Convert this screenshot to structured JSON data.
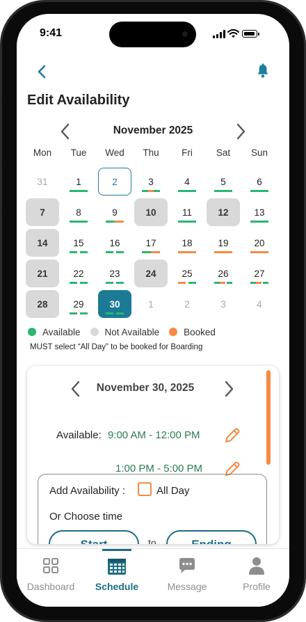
{
  "status_bar": {
    "time": "9:41"
  },
  "header": {
    "title": "Edit Availability"
  },
  "calendar": {
    "month_label": "November 2025",
    "weekdays": [
      "Mon",
      "Tue",
      "Wed",
      "Thu",
      "Fri",
      "Sat",
      "Sun"
    ],
    "days": [
      {
        "label": "31",
        "state": "other-month",
        "bars": []
      },
      {
        "label": "1",
        "state": "normal",
        "bars": [
          "available",
          "available"
        ]
      },
      {
        "label": "2",
        "state": "today",
        "bars": []
      },
      {
        "label": "3",
        "state": "normal",
        "bars": [
          "available",
          "booked",
          "available"
        ]
      },
      {
        "label": "4",
        "state": "normal",
        "bars": [
          "available",
          "available"
        ]
      },
      {
        "label": "5",
        "state": "normal",
        "bars": [
          "available",
          "available"
        ]
      },
      {
        "label": "6",
        "state": "normal",
        "bars": [
          "available",
          "available"
        ]
      },
      {
        "label": "7",
        "state": "not-available",
        "bars": []
      },
      {
        "label": "8",
        "state": "normal",
        "bars": [
          "available",
          "available"
        ]
      },
      {
        "label": "9",
        "state": "normal",
        "bars": [
          "available",
          "booked"
        ]
      },
      {
        "label": "10",
        "state": "not-available",
        "bars": []
      },
      {
        "label": "11",
        "state": "normal",
        "bars": [
          "available",
          "available"
        ]
      },
      {
        "label": "12",
        "state": "not-available",
        "bars": []
      },
      {
        "label": "13",
        "state": "normal",
        "bars": [
          "available",
          "available"
        ]
      },
      {
        "label": "14",
        "state": "not-available",
        "bars": []
      },
      {
        "label": "15",
        "state": "normal",
        "bars": [
          "available",
          "gap",
          "available"
        ]
      },
      {
        "label": "16",
        "state": "normal",
        "bars": [
          "available",
          "gap",
          "available"
        ]
      },
      {
        "label": "17",
        "state": "normal",
        "bars": [
          "available",
          "booked"
        ]
      },
      {
        "label": "18",
        "state": "normal",
        "bars": [
          "booked",
          "booked"
        ]
      },
      {
        "label": "19",
        "state": "normal",
        "bars": [
          "booked",
          "booked"
        ]
      },
      {
        "label": "20",
        "state": "normal",
        "bars": [
          "booked",
          "booked"
        ]
      },
      {
        "label": "21",
        "state": "not-available",
        "bars": []
      },
      {
        "label": "22",
        "state": "normal",
        "bars": [
          "available",
          "gap",
          "available"
        ]
      },
      {
        "label": "23",
        "state": "normal",
        "bars": [
          "available",
          "gap",
          "available"
        ]
      },
      {
        "label": "24",
        "state": "not-available",
        "bars": []
      },
      {
        "label": "25",
        "state": "normal",
        "bars": [
          "booked",
          "gap",
          "available"
        ]
      },
      {
        "label": "26",
        "state": "normal",
        "bars": [
          "available",
          "booked",
          "gap",
          "available"
        ]
      },
      {
        "label": "27",
        "state": "normal",
        "bars": [
          "available",
          "booked",
          "gap",
          "available"
        ]
      },
      {
        "label": "28",
        "state": "not-available",
        "bars": []
      },
      {
        "label": "29",
        "state": "normal",
        "bars": [
          "available",
          "gap",
          "available"
        ]
      },
      {
        "label": "30",
        "state": "selected",
        "bars": [
          "available",
          "gap",
          "available"
        ]
      },
      {
        "label": "1",
        "state": "other-month",
        "bars": []
      },
      {
        "label": "2",
        "state": "other-month",
        "bars": []
      },
      {
        "label": "3",
        "state": "other-month",
        "bars": []
      },
      {
        "label": "4",
        "state": "other-month",
        "bars": []
      }
    ]
  },
  "legend": {
    "available": "Available",
    "not_available": "Not Available",
    "booked": "Booked",
    "note": "MUST select “All Day” to be booked for Boarding"
  },
  "colors": {
    "available": "#2bb673",
    "not_available": "#d9d9d9",
    "booked": "#f58a42",
    "accent": "#1b6e86"
  },
  "detail": {
    "date_label": "November 30, 2025",
    "available_label": "Available:",
    "slots": [
      "9:00 AM - 12:00 PM",
      "1:00 PM - 5:00 PM"
    ],
    "add_label": "Add Availability :",
    "all_day_label": "All Day",
    "choose_label": "Or Choose time",
    "start_label": "Start",
    "to_label": "to",
    "end_label": "Ending"
  },
  "tabs": [
    {
      "label": "Dashboard",
      "icon": "dashboard-icon",
      "active": false
    },
    {
      "label": "Schedule",
      "icon": "calendar-icon",
      "active": true
    },
    {
      "label": "Message",
      "icon": "chat-icon",
      "active": false
    },
    {
      "label": "Profile",
      "icon": "profile-icon",
      "active": false
    }
  ]
}
